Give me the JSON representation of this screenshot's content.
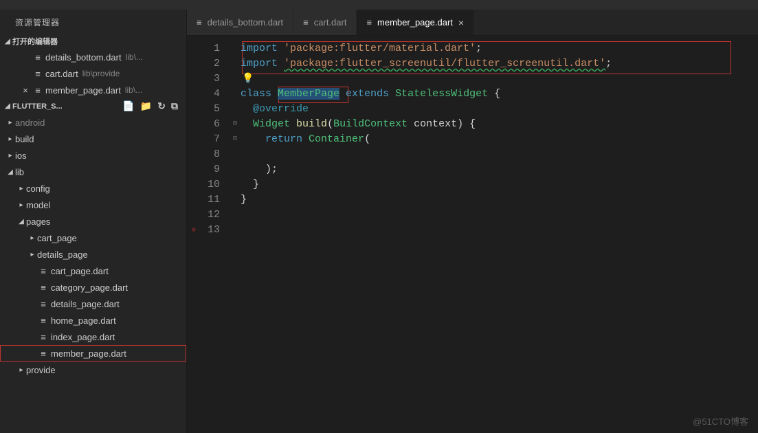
{
  "panel_title": "资源管理器",
  "sections": {
    "open_editors": {
      "label": "打开的编辑器",
      "items": [
        {
          "name": "details_bottom.dart",
          "path": "lib\\...",
          "dirty": false
        },
        {
          "name": "cart.dart",
          "path": "lib\\provide",
          "dirty": false
        },
        {
          "name": "member_page.dart",
          "path": "lib\\...",
          "dirty": true
        }
      ]
    },
    "project": {
      "label": "FLUTTER_S...",
      "actions": {
        "new_file": "new-file-icon",
        "new_folder": "new-folder-icon",
        "refresh": "refresh-icon",
        "collapse": "collapse-all-icon"
      }
    }
  },
  "tree": [
    {
      "depth": 0,
      "kind": "folder",
      "label": "android",
      "state": "closed",
      "cut": true
    },
    {
      "depth": 0,
      "kind": "folder",
      "label": "build",
      "state": "closed"
    },
    {
      "depth": 0,
      "kind": "folder",
      "label": "ios",
      "state": "closed"
    },
    {
      "depth": 0,
      "kind": "folder",
      "label": "lib",
      "state": "open"
    },
    {
      "depth": 1,
      "kind": "folder",
      "label": "config",
      "state": "closed"
    },
    {
      "depth": 1,
      "kind": "folder",
      "label": "model",
      "state": "closed"
    },
    {
      "depth": 1,
      "kind": "folder",
      "label": "pages",
      "state": "open"
    },
    {
      "depth": 2,
      "kind": "folder",
      "label": "cart_page",
      "state": "closed"
    },
    {
      "depth": 2,
      "kind": "folder",
      "label": "details_page",
      "state": "closed"
    },
    {
      "depth": 2,
      "kind": "file",
      "label": "cart_page.dart"
    },
    {
      "depth": 2,
      "kind": "file",
      "label": "category_page.dart"
    },
    {
      "depth": 2,
      "kind": "file",
      "label": "details_page.dart"
    },
    {
      "depth": 2,
      "kind": "file",
      "label": "home_page.dart"
    },
    {
      "depth": 2,
      "kind": "file",
      "label": "index_page.dart"
    },
    {
      "depth": 2,
      "kind": "file",
      "label": "member_page.dart",
      "selected": true
    },
    {
      "depth": 1,
      "kind": "folder",
      "label": "provide",
      "state": "closed"
    }
  ],
  "tabs": [
    {
      "label": "details_bottom.dart",
      "active": false
    },
    {
      "label": "cart.dart",
      "active": false
    },
    {
      "label": "member_page.dart",
      "active": true,
      "closeable": true
    }
  ],
  "code": {
    "lines": [
      {
        "n": 1,
        "tokens": [
          [
            "k",
            "import "
          ],
          [
            "s",
            "'package:flutter/material.dart'"
          ],
          [
            "p",
            ";"
          ]
        ]
      },
      {
        "n": 2,
        "tokens": [
          [
            "k",
            "import "
          ],
          [
            "sq",
            "'package:flutter_screenutil/flutter_screenutil.dart'"
          ],
          [
            "p",
            ";"
          ]
        ]
      },
      {
        "n": 3,
        "tokens": [],
        "bulb": true
      },
      {
        "n": 4,
        "tokens": [
          [
            "k",
            "class "
          ],
          [
            "tsel",
            "MemberPage"
          ],
          [
            "c",
            " "
          ],
          [
            "k",
            "extends "
          ],
          [
            "t",
            "StatelessWidget"
          ],
          [
            "c",
            " {"
          ]
        ]
      },
      {
        "n": 5,
        "tokens": [
          [
            "c",
            "  "
          ],
          [
            "a",
            "@override"
          ]
        ]
      },
      {
        "n": 6,
        "tokens": [
          [
            "c",
            "  "
          ],
          [
            "t",
            "Widget"
          ],
          [
            "c",
            " "
          ],
          [
            "fn",
            "build"
          ],
          [
            "c",
            "("
          ],
          [
            "t",
            "BuildContext"
          ],
          [
            "c",
            " context) {"
          ]
        ],
        "fold": true
      },
      {
        "n": 7,
        "tokens": [
          [
            "c",
            "    "
          ],
          [
            "k",
            "return"
          ],
          [
            "c",
            " "
          ],
          [
            "t",
            "Container"
          ],
          [
            "c",
            "("
          ]
        ],
        "fold": true
      },
      {
        "n": 8,
        "tokens": [
          [
            "c",
            "      "
          ]
        ]
      },
      {
        "n": 9,
        "tokens": [
          [
            "c",
            "    );"
          ]
        ]
      },
      {
        "n": 10,
        "tokens": [
          [
            "c",
            "  }"
          ]
        ]
      },
      {
        "n": 11,
        "tokens": [
          [
            "c",
            "}"
          ]
        ]
      },
      {
        "n": 12,
        "tokens": []
      },
      {
        "n": 13,
        "tokens": [],
        "bp": true
      }
    ],
    "highlighted_class": "MemberPage"
  },
  "watermark": "@51CTO博客"
}
